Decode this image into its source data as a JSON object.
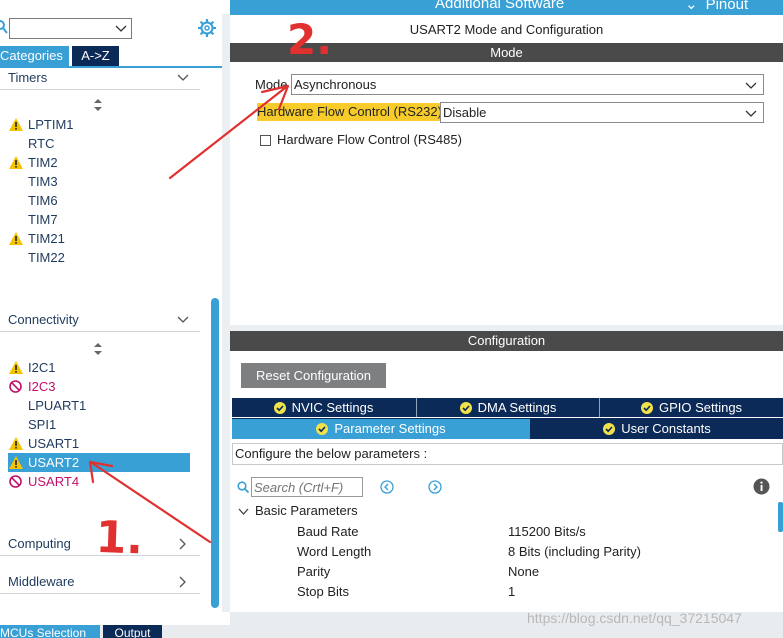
{
  "header": {
    "additional_software": "Additional Software",
    "pinout": "Pinout"
  },
  "sidebar": {
    "search_placeholder": "",
    "tabs": {
      "categories": "Categories",
      "az": "A->Z"
    },
    "sections": [
      {
        "label": "Timers"
      },
      {
        "label": "Connectivity"
      },
      {
        "label": "Computing"
      },
      {
        "label": "Middleware"
      }
    ],
    "timers": [
      {
        "label": "LPTIM1",
        "status": "warning"
      },
      {
        "label": "RTC",
        "status": "none"
      },
      {
        "label": "TIM2",
        "status": "warning"
      },
      {
        "label": "TIM3",
        "status": "none"
      },
      {
        "label": "TIM6",
        "status": "none"
      },
      {
        "label": "TIM7",
        "status": "none"
      },
      {
        "label": "TIM21",
        "status": "warning"
      },
      {
        "label": "TIM22",
        "status": "none"
      }
    ],
    "connectivity": [
      {
        "label": "I2C1",
        "status": "warning"
      },
      {
        "label": "I2C3",
        "status": "error"
      },
      {
        "label": "LPUART1",
        "status": "none"
      },
      {
        "label": "SPI1",
        "status": "none"
      },
      {
        "label": "USART1",
        "status": "warning"
      },
      {
        "label": "USART2",
        "status": "warning",
        "selected": true
      },
      {
        "label": "USART4",
        "status": "error"
      }
    ]
  },
  "bottom_tabs": {
    "mcus_selection": "MCUs Selection",
    "output": "Output"
  },
  "main": {
    "title": "USART2 Mode and Configuration",
    "mode_bar": "Mode",
    "mode": {
      "label": "Mode",
      "value": "Asynchronous"
    },
    "hw_flow_232": {
      "label": "Hardware Flow Control (RS232)",
      "value": "Disable"
    },
    "hw_flow_485": {
      "label": "Hardware Flow Control (RS485)",
      "checked": false
    },
    "configuration_bar": "Configuration",
    "reset_button": "Reset Configuration",
    "tabs_row1": [
      "NVIC Settings",
      "DMA Settings",
      "GPIO Settings"
    ],
    "tabs_row2": [
      "Parameter Settings",
      "User Constants"
    ],
    "active_tab": "Parameter Settings",
    "configure_message": "Configure the below parameters :",
    "param_search_placeholder": "Search (Crtl+F)",
    "group": "Basic Parameters",
    "parameters": [
      {
        "name": "Baud Rate",
        "value": "115200 Bits/s"
      },
      {
        "name": "Word Length",
        "value": "8 Bits (including Parity)"
      },
      {
        "name": "Parity",
        "value": "None"
      },
      {
        "name": "Stop Bits",
        "value": "1"
      }
    ]
  },
  "annotations": {
    "step1": "1.",
    "step2": "2."
  },
  "watermark": "https://blog.csdn.net/qq_37215047",
  "colors": {
    "accent": "#39a0d6",
    "navy": "#0b2a57",
    "dark_bar": "#4a4a4a",
    "highlight": "#f7cc2a",
    "error": "#c0106a",
    "annotation": "#e03030"
  }
}
